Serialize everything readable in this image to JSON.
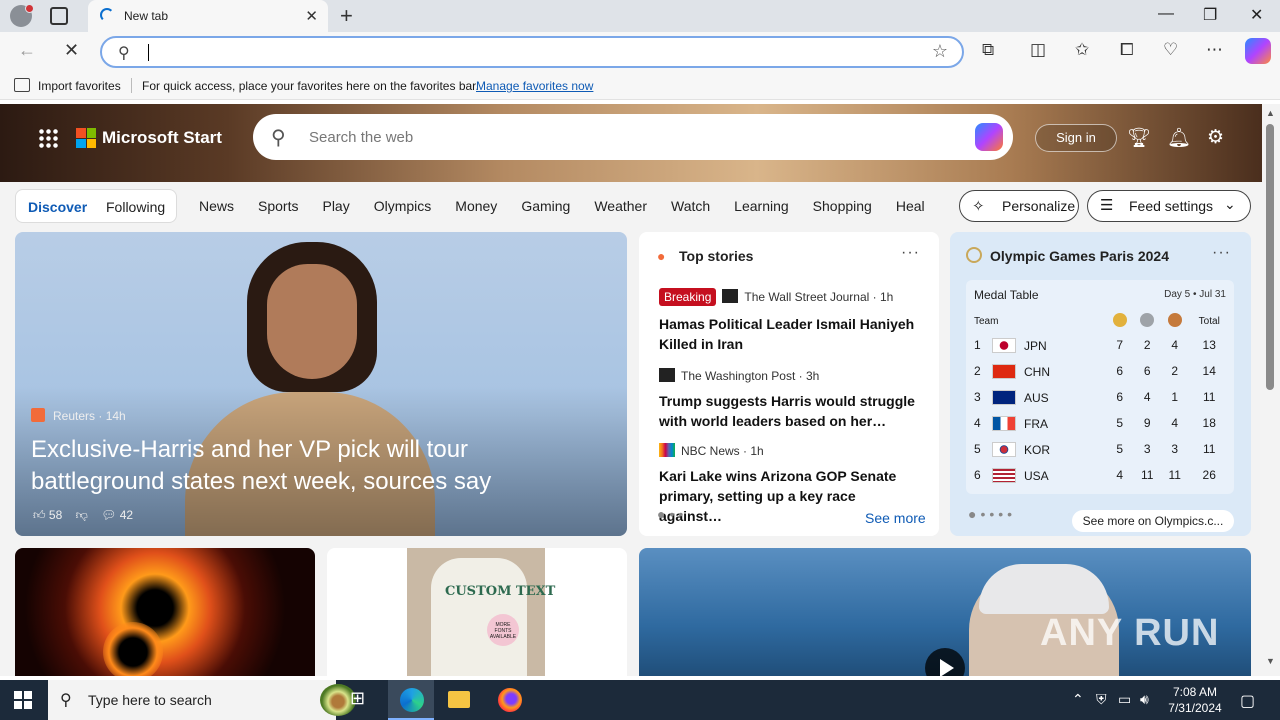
{
  "browser": {
    "tab_title": "New tab",
    "new_tab_symbol": "+",
    "close_tab_symbol": "✕",
    "favorites_bar": {
      "import_label": "Import favorites",
      "hint": "For quick access, place your favorites here on the favorites bar.",
      "manage_link": "Manage favorites now"
    }
  },
  "header": {
    "brand": "Microsoft Start",
    "search_placeholder": "Search the web",
    "sign_in": "Sign in"
  },
  "nav": {
    "primary": [
      "Discover",
      "Following"
    ],
    "links": [
      "News",
      "Sports",
      "Play",
      "Olympics",
      "Money",
      "Gaming",
      "Weather",
      "Watch",
      "Learning",
      "Shopping",
      "Heal"
    ],
    "personalize": "Personalize",
    "feed_settings": "Feed settings"
  },
  "hero": {
    "source": "Reuters",
    "age": "14h",
    "headline": "Exclusive-Harris and her VP pick will tour battleground states next week, sources say",
    "likes": "58",
    "comments": "42"
  },
  "top_stories": {
    "title": "Top stories",
    "items": [
      {
        "badge": "Breaking",
        "source": "The Wall Street Journal",
        "age": "1h",
        "headline": "Hamas Political Leader Ismail Haniyeh Killed in Iran"
      },
      {
        "badge": "",
        "source": "The Washington Post",
        "age": "3h",
        "headline": "Trump suggests Harris would struggle with world leaders based on her…"
      },
      {
        "badge": "",
        "source": "NBC News",
        "age": "1h",
        "headline": "Kari Lake wins Arizona GOP Senate primary, setting up a key race against…"
      }
    ],
    "see_more": "See more"
  },
  "olympics": {
    "title": "Olympic Games Paris 2024",
    "medal_table_label": "Medal Table",
    "day": "Day 5 • Jul 31",
    "columns": {
      "team": "Team",
      "total": "Total"
    },
    "rows": [
      {
        "rank": "1",
        "team": "JPN",
        "gold": "7",
        "silver": "2",
        "bronze": "4",
        "total": "13"
      },
      {
        "rank": "2",
        "team": "CHN",
        "gold": "6",
        "silver": "6",
        "bronze": "2",
        "total": "14"
      },
      {
        "rank": "3",
        "team": "AUS",
        "gold": "6",
        "silver": "4",
        "bronze": "1",
        "total": "11"
      },
      {
        "rank": "4",
        "team": "FRA",
        "gold": "5",
        "silver": "9",
        "bronze": "4",
        "total": "18"
      },
      {
        "rank": "5",
        "team": "KOR",
        "gold": "5",
        "silver": "3",
        "bronze": "3",
        "total": "11"
      },
      {
        "rank": "6",
        "team": "USA",
        "gold": "4",
        "silver": "11",
        "bronze": "11",
        "total": "26"
      }
    ],
    "see_more": "See more on Olympics.c..."
  },
  "cards": {
    "shirt_text": "CUSTOM TEXT",
    "shirt_badge": "MORE FONTS AVAILABLE"
  },
  "watermark": "ANY RUN",
  "taskbar": {
    "search_placeholder": "Type here to search",
    "time": "7:08 AM",
    "date": "7/31/2024"
  },
  "colors": {
    "accent": "#0f5bb5",
    "breaking": "#c50f1f",
    "taskbar": "#1c2a3a"
  }
}
